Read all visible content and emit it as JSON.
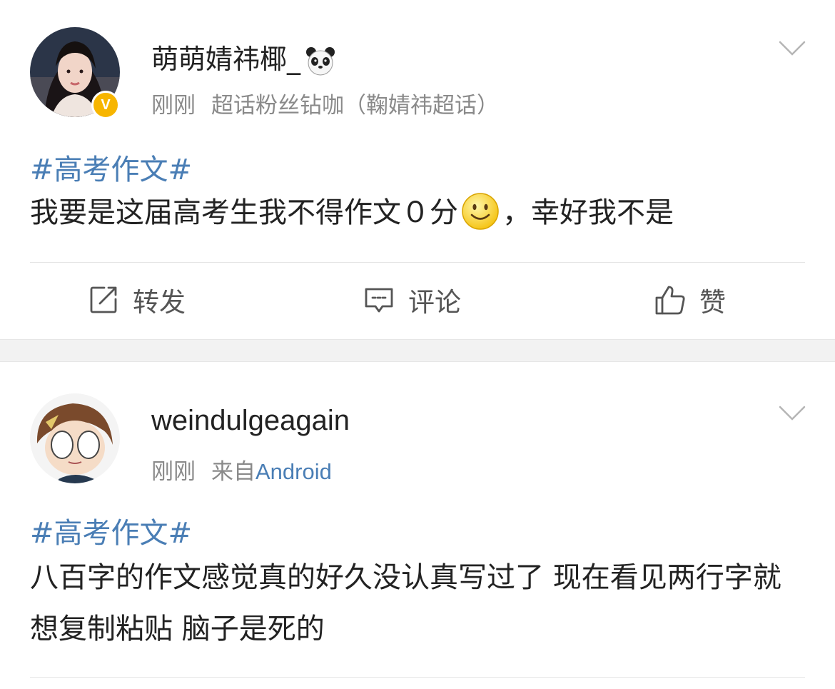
{
  "posts": [
    {
      "username": "萌萌婧祎椰_",
      "time": "刚刚",
      "source": "超话粉丝钻咖（鞠婧祎超话）",
      "verified_badge": "V",
      "hashtag": "#高考作文#",
      "content_before": "我要是这届高考生我不得作文０分",
      "content_after": "，幸好我不是",
      "emoji": "smile-icon",
      "actions": {
        "repost": "转发",
        "comment": "评论",
        "like": "赞"
      }
    },
    {
      "username": "weindulgeagain",
      "time": "刚刚",
      "source_prefix": "来自",
      "source_link": "Android",
      "hashtag": "#高考作文#",
      "content": "八百字的作文感觉真的好久没认真写过了 现在看见两行字就想复制粘贴 脑子是死的"
    }
  ],
  "colors": {
    "link": "#4a7eb5",
    "meta": "#8a8a8a",
    "badge": "#f7b500",
    "separator": "#f2f2f2"
  }
}
